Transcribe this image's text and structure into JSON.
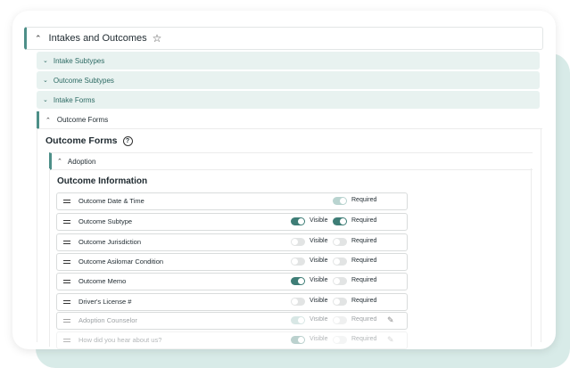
{
  "section": {
    "title": "Intakes and Outcomes",
    "chevron_icon": "chevron-up-icon",
    "star_icon": "star-icon"
  },
  "subpanels": [
    {
      "label": "Intake Subtypes"
    },
    {
      "label": "Outcome Subtypes"
    },
    {
      "label": "Intake Forms"
    }
  ],
  "open_panel": {
    "label": "Outcome Forms"
  },
  "forms": {
    "title": "Outcome Forms",
    "help_icon": "?"
  },
  "adoption": {
    "label": "Adoption"
  },
  "info": {
    "title": "Outcome Information"
  },
  "labels": {
    "visible": "Visible",
    "required": "Required"
  },
  "fields": [
    {
      "name": "Outcome Date & Time",
      "visible": null,
      "required": true
    },
    {
      "name": "Outcome Subtype",
      "visible": true,
      "required": true
    },
    {
      "name": "Outcome Jurisdiction",
      "visible": false,
      "required": false
    },
    {
      "name": "Outcome Asilomar Condition",
      "visible": false,
      "required": false
    },
    {
      "name": "Outcome Memo",
      "visible": true,
      "required": false
    },
    {
      "name": "Driver's License #",
      "visible": false,
      "required": false
    },
    {
      "name": "Adoption Counselor",
      "visible": true,
      "required": false
    },
    {
      "name": "How did you hear about us?",
      "visible": true,
      "required": false
    }
  ],
  "colors": {
    "accent": "#4d8f88",
    "toggle_on": "#3e7d76",
    "subpanel_bg": "#e8f2f0"
  }
}
